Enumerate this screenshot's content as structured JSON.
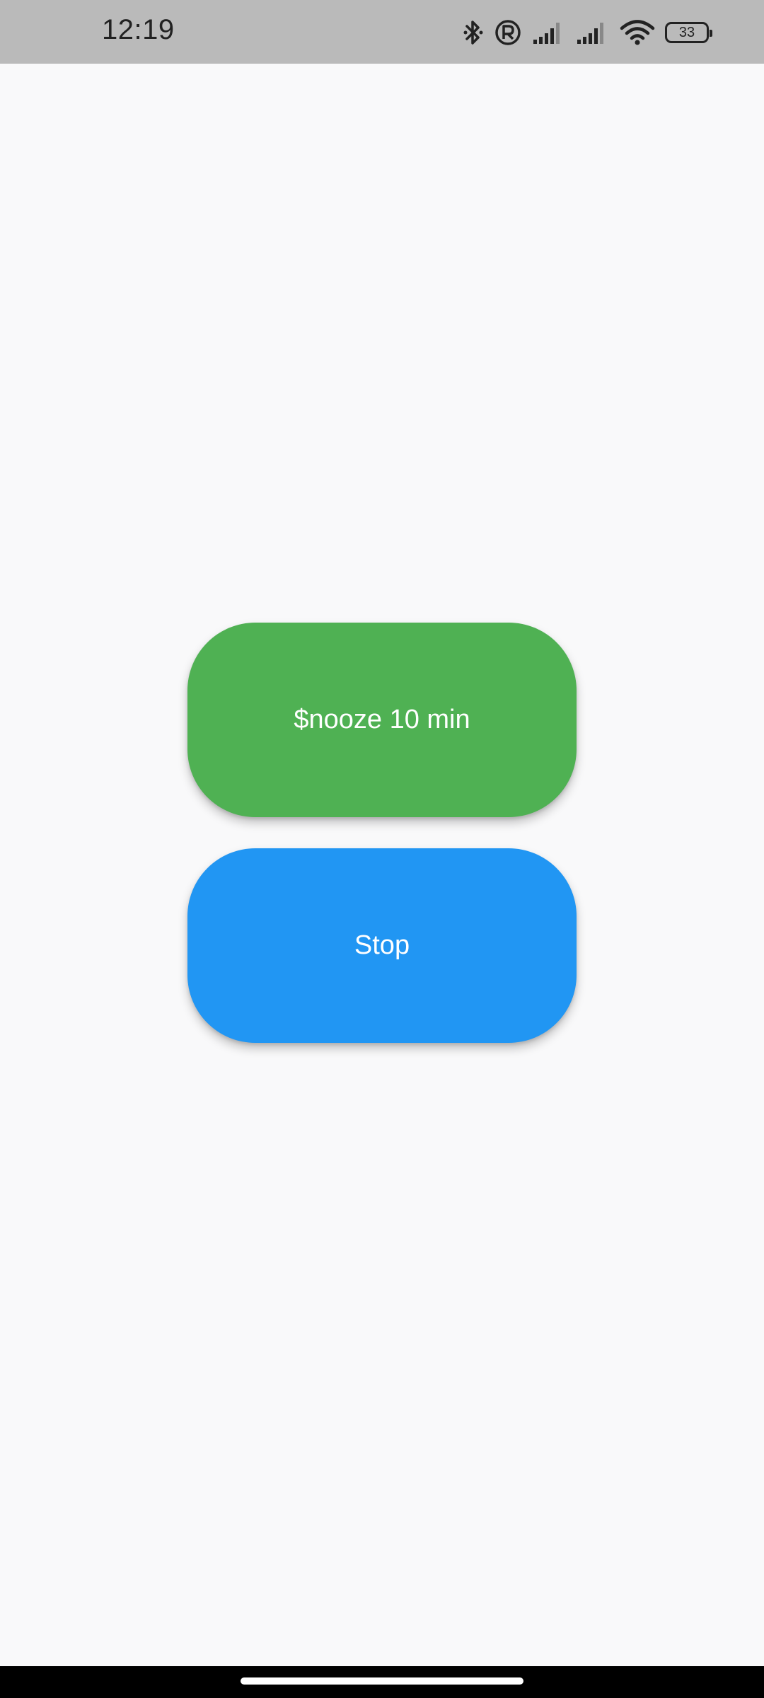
{
  "status_bar": {
    "time": "12:19",
    "icons": [
      "bluetooth-icon",
      "registered-icon",
      "signal-icon",
      "signal-icon",
      "wifi-icon",
      "battery-icon"
    ],
    "battery_level": "33"
  },
  "actions": {
    "snooze_label": "$nooze 10 min",
    "stop_label": "Stop"
  },
  "colors": {
    "snooze": "#4FB153",
    "stop": "#2196F3",
    "background": "#F9F9FA",
    "status_bar": "#BABABA"
  }
}
